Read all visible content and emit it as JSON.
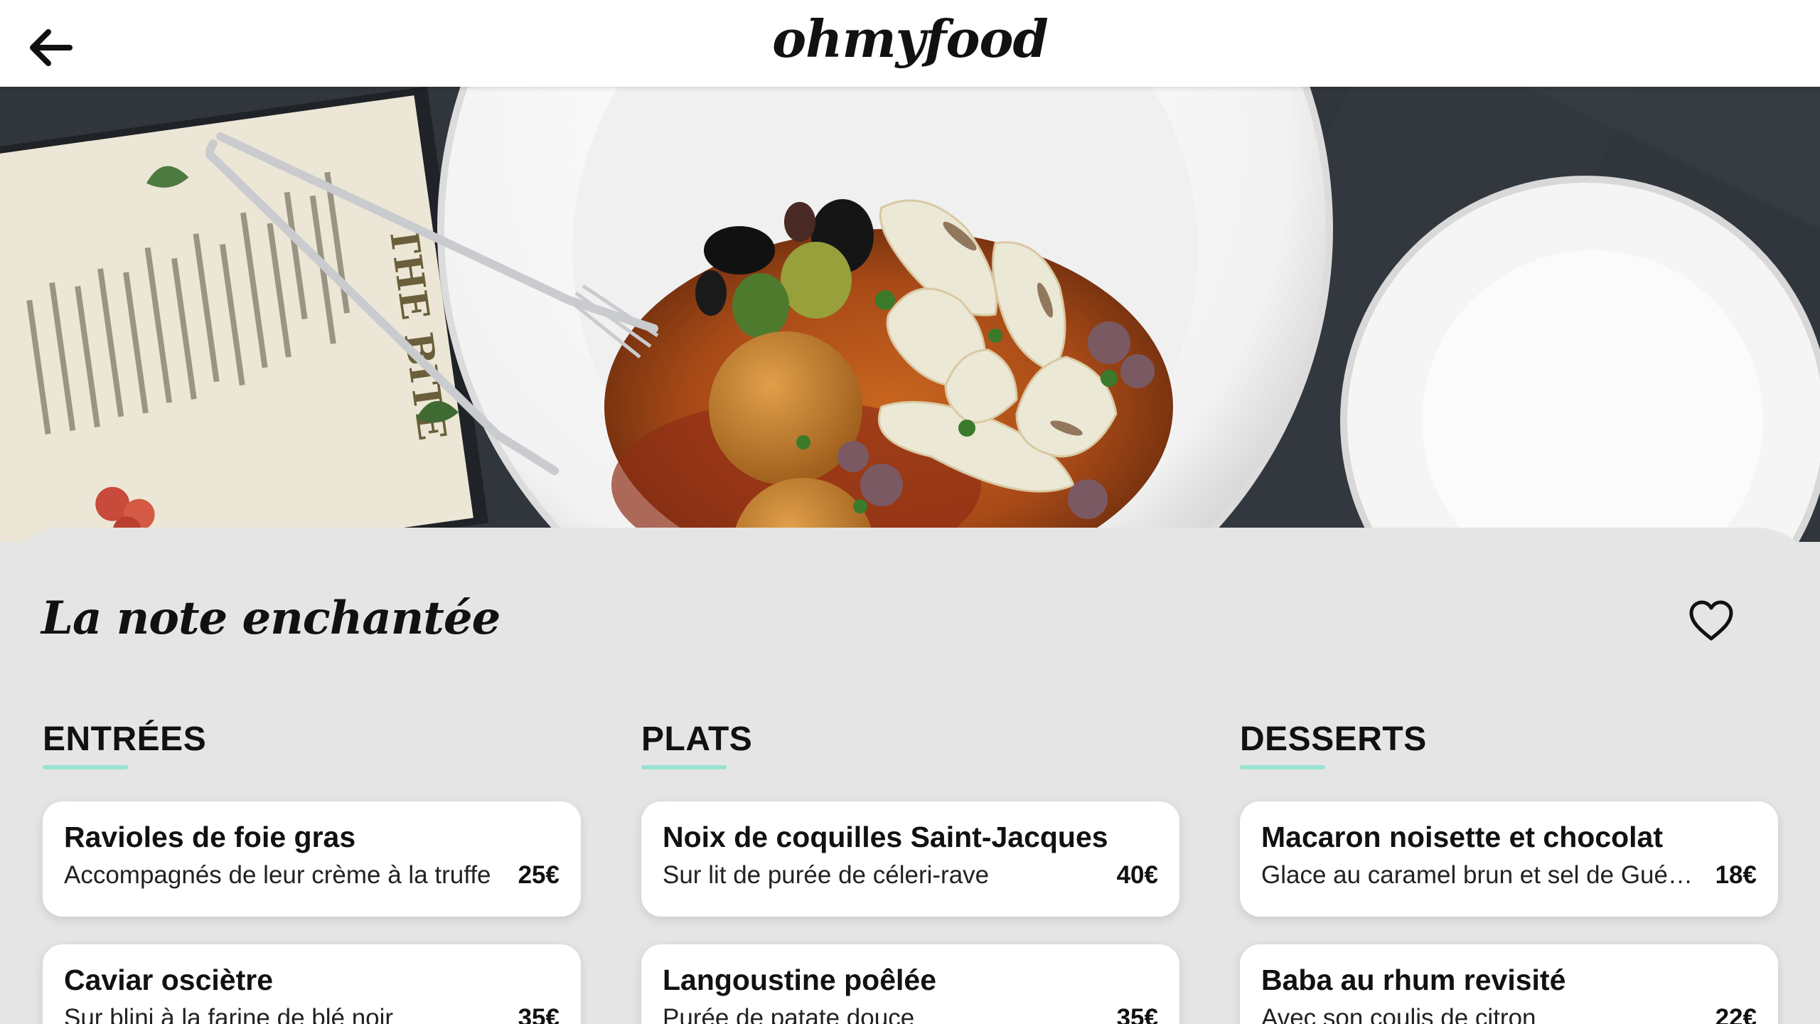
{
  "header": {
    "logo": "ohmyfood",
    "back_icon": "arrow-left-icon"
  },
  "restaurant": {
    "name": "La note enchantée",
    "favorite_icon": "heart-outline-icon"
  },
  "colors": {
    "accent": "#99e2d0",
    "background": "#e5e5e5",
    "card": "#ffffff"
  },
  "menu": {
    "entrees": {
      "title": "ENTRÉES",
      "dishes": [
        {
          "name": "Ravioles de foie gras",
          "description": "Accompagnés de leur crème à la truffe",
          "price": "25€"
        },
        {
          "name": "Caviar osciètre",
          "description": "Sur blini à la farine de blé noir",
          "price": "35€"
        }
      ]
    },
    "plats": {
      "title": "PLATS",
      "dishes": [
        {
          "name": "Noix de coquilles Saint-Jacques",
          "description": "Sur lit de purée de céleri-rave",
          "price": "40€"
        },
        {
          "name": "Langoustine poêlée",
          "description": "Purée de patate douce",
          "price": "35€"
        }
      ]
    },
    "desserts": {
      "title": "DESSERTS",
      "dishes": [
        {
          "name": "Macaron noisette et chocolat",
          "description": "Glace au caramel brun et sel de Guérande",
          "price": "18€"
        },
        {
          "name": "Baba au rhum revisité",
          "description": "Avec son coulis de citron",
          "price": "22€"
        }
      ]
    }
  }
}
